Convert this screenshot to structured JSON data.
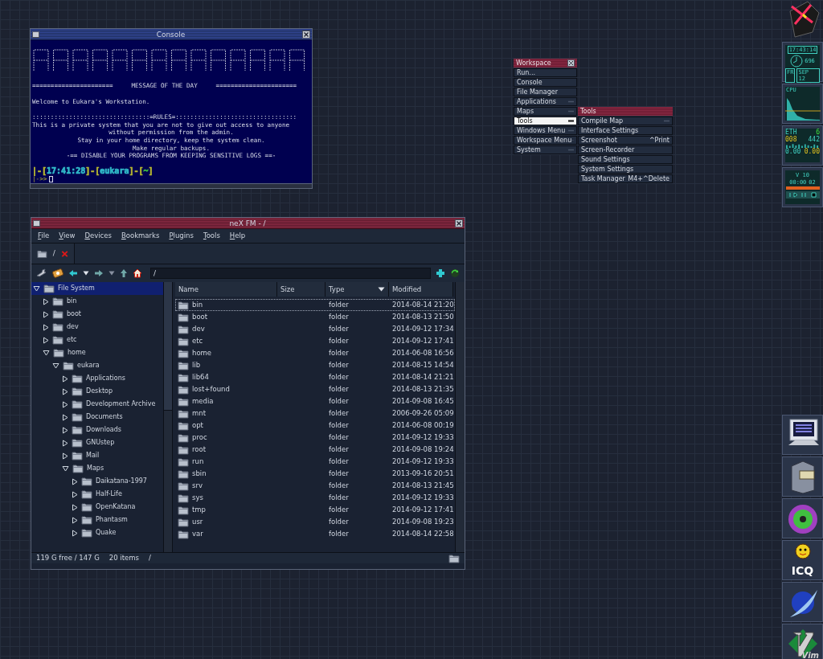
{
  "console": {
    "title": "Console",
    "motd_rule": "======================     MESSAGE OF THE DAY     ======================",
    "welcome": "Welcome to Eukara's Workstation.",
    "rules_rule": "::::::::::::::::::::::::::::::::=RULES=:::::::::::::::::::::::::::::::::",
    "rules_lead": "This is a private system that you are not to give out access to anyone",
    "rules": [
      "without permission from the admin.",
      "Stay in your home directory, keep the system clean.",
      "Make regular backups.",
      "-== DISABLE YOUR PROGRAMS FROM KEEPING SENSITIVE LOGS ==-"
    ],
    "prompt": [
      {
        "text": "|-[",
        "color": "#b8b830"
      },
      {
        "text": "17:41:28",
        "color": "#30b8c8"
      },
      {
        "text": "]-[",
        "color": "#b8b830"
      },
      {
        "text": "eukara",
        "color": "#30b8c8"
      },
      {
        "text": "]-[",
        "color": "#b8b830"
      },
      {
        "text": "~",
        "color": "#40c040"
      },
      {
        "text": "]",
        "color": "#b8b830"
      }
    ],
    "input_prefix": "|->>"
  },
  "file_manager": {
    "title": "neX FM - /",
    "menu": [
      "File",
      "View",
      "Devices",
      "Bookmarks",
      "Plugins",
      "Tools",
      "Help"
    ],
    "tab": {
      "label": "/"
    },
    "path": "/",
    "tree": [
      {
        "label": "File System",
        "expanded": true,
        "selected": true,
        "children": [
          {
            "label": "bin",
            "expanded": false,
            "selected": false
          },
          {
            "label": "boot",
            "expanded": false,
            "selected": false
          },
          {
            "label": "dev",
            "expanded": false,
            "selected": false
          },
          {
            "label": "etc",
            "expanded": false,
            "selected": false
          },
          {
            "label": "home",
            "expanded": true,
            "selected": false,
            "children": [
              {
                "label": "eukara",
                "expanded": true,
                "selected": false,
                "children": [
                  {
                    "label": "Applications",
                    "expanded": false,
                    "selected": false
                  },
                  {
                    "label": "Desktop",
                    "expanded": false,
                    "selected": false
                  },
                  {
                    "label": "Development Archive",
                    "expanded": false,
                    "selected": false
                  },
                  {
                    "label": "Documents",
                    "expanded": false,
                    "selected": false
                  },
                  {
                    "label": "Downloads",
                    "expanded": false,
                    "selected": false
                  },
                  {
                    "label": "GNUstep",
                    "expanded": false,
                    "selected": false
                  },
                  {
                    "label": "Mail",
                    "expanded": false,
                    "selected": false
                  },
                  {
                    "label": "Maps",
                    "expanded": true,
                    "selected": false,
                    "children": [
                      {
                        "label": "Daikatana-1997",
                        "expanded": false,
                        "selected": false
                      },
                      {
                        "label": "Half-Life",
                        "expanded": false,
                        "selected": false
                      },
                      {
                        "label": "OpenKatana",
                        "expanded": false,
                        "selected": false
                      },
                      {
                        "label": "Phantasm",
                        "expanded": false,
                        "selected": false
                      },
                      {
                        "label": "Quake",
                        "expanded": false,
                        "selected": false
                      }
                    ]
                  }
                ]
              }
            ]
          }
        ]
      }
    ],
    "columns": [
      {
        "label": "Name",
        "sorted": false
      },
      {
        "label": "Size",
        "sorted": false
      },
      {
        "label": "Type",
        "sorted": true
      },
      {
        "label": "Modified",
        "sorted": false
      }
    ],
    "rows": [
      {
        "name": "bin",
        "type": "folder",
        "modified": "2014-08-14 21:20",
        "selected": true
      },
      {
        "name": "boot",
        "type": "folder",
        "modified": "2014-08-13 21:50",
        "selected": false
      },
      {
        "name": "dev",
        "type": "folder",
        "modified": "2014-09-12 17:34",
        "selected": false
      },
      {
        "name": "etc",
        "type": "folder",
        "modified": "2014-09-12 17:41",
        "selected": false
      },
      {
        "name": "home",
        "type": "folder",
        "modified": "2014-06-08 16:56",
        "selected": false
      },
      {
        "name": "lib",
        "type": "folder",
        "modified": "2014-08-15 14:54",
        "selected": false
      },
      {
        "name": "lib64",
        "type": "folder",
        "modified": "2014-08-14 21:21",
        "selected": false
      },
      {
        "name": "lost+found",
        "type": "folder",
        "modified": "2014-08-13 21:35",
        "selected": false
      },
      {
        "name": "media",
        "type": "folder",
        "modified": "2014-09-08 16:45",
        "selected": false
      },
      {
        "name": "mnt",
        "type": "folder",
        "modified": "2006-09-26 05:09",
        "selected": false
      },
      {
        "name": "opt",
        "type": "folder",
        "modified": "2014-06-08 00:19",
        "selected": false
      },
      {
        "name": "proc",
        "type": "folder",
        "modified": "2014-09-12 19:33",
        "selected": false
      },
      {
        "name": "root",
        "type": "folder",
        "modified": "2014-09-08 19:24",
        "selected": false
      },
      {
        "name": "run",
        "type": "folder",
        "modified": "2014-09-12 19:33",
        "selected": false
      },
      {
        "name": "sbin",
        "type": "folder",
        "modified": "2013-09-16 20:51",
        "selected": false
      },
      {
        "name": "srv",
        "type": "folder",
        "modified": "2014-08-13 21:45",
        "selected": false
      },
      {
        "name": "sys",
        "type": "folder",
        "modified": "2014-09-12 19:33",
        "selected": false
      },
      {
        "name": "tmp",
        "type": "folder",
        "modified": "2014-09-12 17:41",
        "selected": false
      },
      {
        "name": "usr",
        "type": "folder",
        "modified": "2014-09-08 19:23",
        "selected": false
      },
      {
        "name": "var",
        "type": "folder",
        "modified": "2014-08-14 22:58",
        "selected": false
      }
    ],
    "status": {
      "free": "119 G free / 147 G",
      "items": "20 items",
      "path": "/"
    }
  },
  "workspace_menu": {
    "title": "Workspace",
    "items": [
      {
        "label": "Run...",
        "submenu": false,
        "selected": false
      },
      {
        "label": "Console",
        "submenu": false,
        "selected": false
      },
      {
        "label": "File Manager",
        "submenu": false,
        "selected": false
      },
      {
        "label": "Applications",
        "submenu": true,
        "selected": false
      },
      {
        "label": "Maps",
        "submenu": true,
        "selected": false
      },
      {
        "label": "Tools",
        "submenu": true,
        "selected": true
      },
      {
        "label": "Windows Menu",
        "submenu": true,
        "selected": false
      },
      {
        "label": "Workspace Menu",
        "submenu": true,
        "selected": false
      },
      {
        "label": "System",
        "submenu": true,
        "selected": false
      }
    ]
  },
  "tools_menu": {
    "title": "Tools",
    "items": [
      {
        "label": "Compile Map",
        "submenu": true
      },
      {
        "label": "Interface Settings",
        "submenu": false
      },
      {
        "label": "Screenshot",
        "shortcut": "^Print",
        "submenu": false
      },
      {
        "label": "Screen-Recorder",
        "submenu": false
      },
      {
        "label": "Sound Settings",
        "submenu": false
      },
      {
        "label": "System Settings",
        "submenu": false
      },
      {
        "label": "Task Manager",
        "shortcut": "M4+^Delete",
        "submenu": false
      }
    ]
  },
  "dock": {
    "clock": {
      "time": "17:43:14",
      "field_2": "696",
      "weekday": "FR",
      "date": "SEP 12"
    },
    "cpu": {
      "label": "CPU"
    },
    "network": {
      "label": "ETH",
      "value": "6",
      "down": "008",
      "up": "442",
      "down_rate": "0.00",
      "up_rate": "0.00"
    },
    "player": {
      "volume": "V 10",
      "time": "00:00",
      "track": "02"
    },
    "launchers": [
      {
        "kind": "monitor"
      },
      {
        "kind": "cabinet"
      },
      {
        "kind": "disc"
      },
      {
        "kind": "icq",
        "label": "ICQ"
      },
      {
        "kind": "bird"
      },
      {
        "kind": "vim",
        "label": "Vim"
      }
    ]
  }
}
